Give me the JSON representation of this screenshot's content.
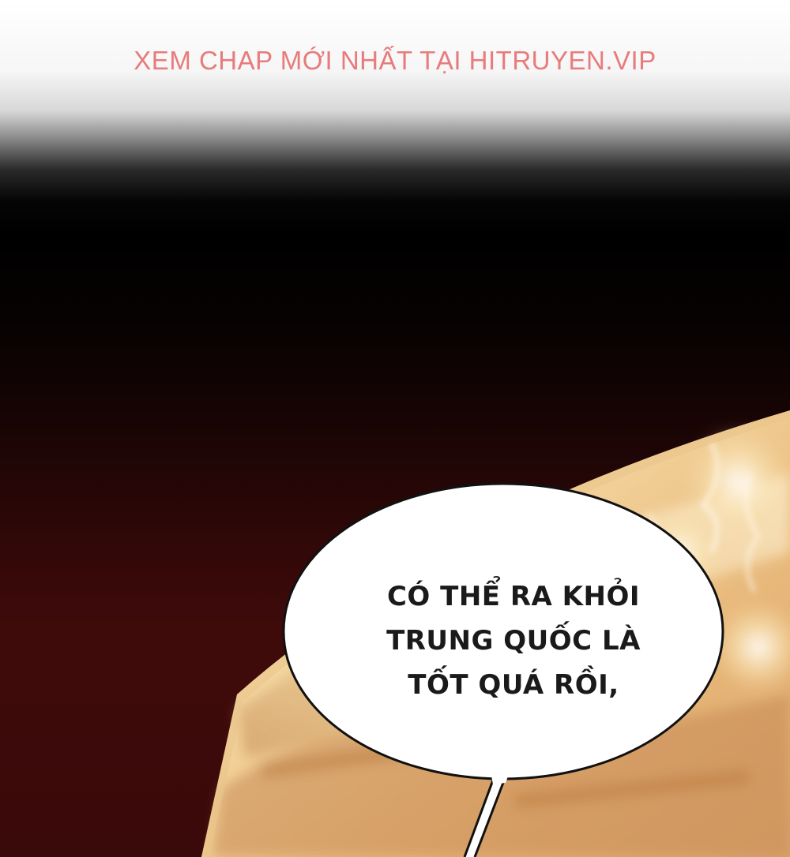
{
  "watermark": "XEM CHAP MỚI NHẤT TẠI HITRUYEN.VIP",
  "speech_bubble": {
    "lines": [
      "CÓ THỂ RA KHỎI",
      "TRUNG QUỐC LÀ",
      "TỐT QUÁ RỒI,"
    ]
  },
  "colors": {
    "watermark": "#e87b7b",
    "background_dark_red": "#3a0909",
    "warm_light": "#f3d9a4",
    "bubble_fill": "#ffffff",
    "bubble_outline": "#111111"
  }
}
